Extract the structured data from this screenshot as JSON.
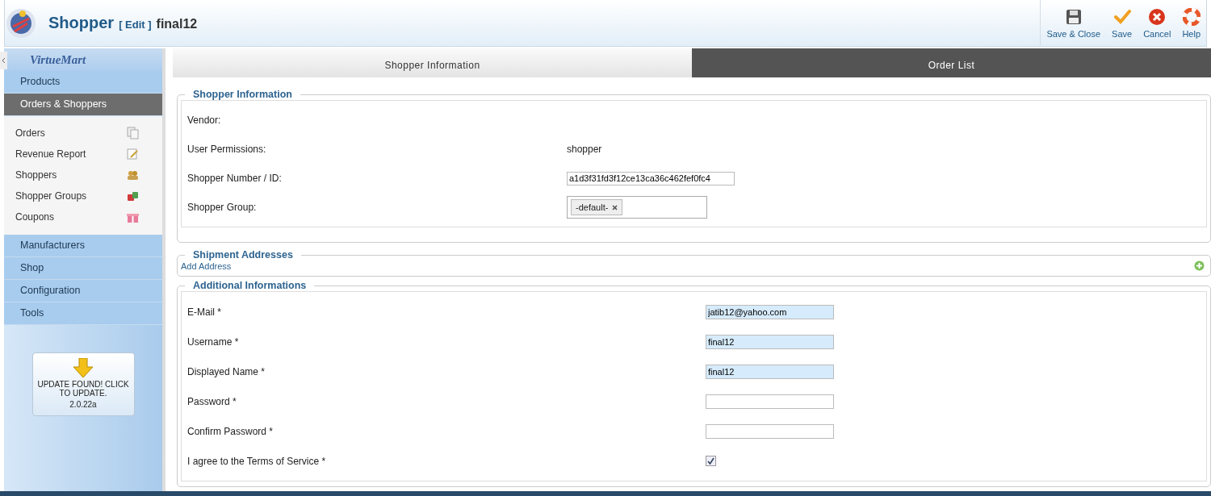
{
  "header": {
    "title": "Shopper",
    "edit_label": "[ Edit ]",
    "record": "final12",
    "toolbar": [
      {
        "label": "Save & Close",
        "kind": "save-close"
      },
      {
        "label": "Save",
        "kind": "save"
      },
      {
        "label": "Cancel",
        "kind": "cancel"
      },
      {
        "label": "Help",
        "kind": "help"
      }
    ]
  },
  "sidebar": {
    "logo": "VirtueMart",
    "menu": [
      {
        "label": "Products",
        "selected": false
      },
      {
        "label": "Orders & Shoppers",
        "selected": true,
        "children": [
          {
            "label": "Orders",
            "kind": "orders"
          },
          {
            "label": "Revenue Report",
            "kind": "report"
          },
          {
            "label": "Shoppers",
            "kind": "shoppers"
          },
          {
            "label": "Shopper Groups",
            "kind": "groups"
          },
          {
            "label": "Coupons",
            "kind": "coupons"
          }
        ]
      },
      {
        "label": "Manufacturers",
        "selected": false
      },
      {
        "label": "Shop",
        "selected": false
      },
      {
        "label": "Configuration",
        "selected": false
      },
      {
        "label": "Tools",
        "selected": false
      }
    ],
    "update_notice": {
      "message": "UPDATE FOUND! CLICK TO UPDATE.",
      "version": "2.0.22a"
    }
  },
  "tabs": [
    {
      "label": "Shopper Information",
      "selected": true
    },
    {
      "label": "Order List",
      "selected": false
    }
  ],
  "shopper_information": {
    "legend": "Shopper Information",
    "rows": [
      {
        "label": "Vendor:",
        "kind": "text"
      },
      {
        "label": "User Permissions:",
        "kind": "text",
        "value": "shopper"
      },
      {
        "label": "Shopper Number / ID:",
        "kind": "input",
        "value": "a1d3f31fd3f12ce13ca36c462fef0fc4"
      },
      {
        "label": "Shopper Group:",
        "kind": "tags",
        "tags": [
          "-default-"
        ]
      }
    ]
  },
  "shipment_addresses": {
    "legend": "Shipment Addresses",
    "add_link": "Add Address"
  },
  "additional_informations": {
    "legend": "Additional Informations",
    "rows": [
      {
        "label": "E-Mail *",
        "kind": "input",
        "value": "jatib12@yahoo.com",
        "autofilled": true
      },
      {
        "label": "Username *",
        "kind": "input",
        "value": "final12",
        "autofilled": true
      },
      {
        "label": "Displayed Name *",
        "kind": "input",
        "value": "final12",
        "autofilled": true
      },
      {
        "label": "Password *",
        "kind": "input",
        "autofilled": false
      },
      {
        "label": "Confirm Password *",
        "kind": "input",
        "autofilled": false
      },
      {
        "label": "I agree to the Terms of Service *",
        "kind": "checkbox",
        "checked": true
      }
    ]
  }
}
